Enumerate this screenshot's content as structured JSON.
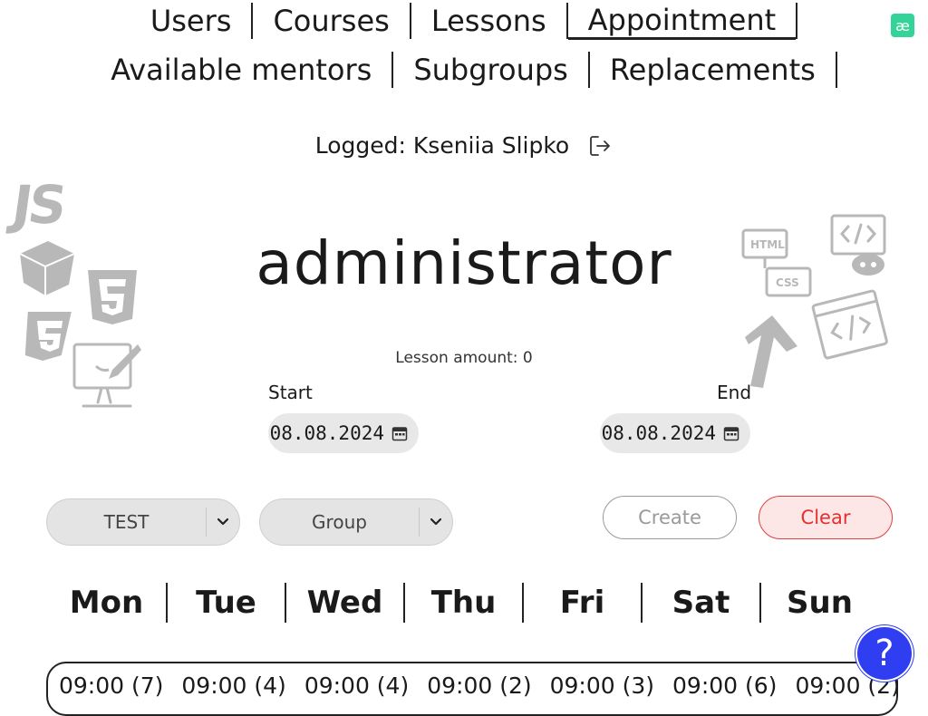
{
  "nav": {
    "row1": [
      "Users",
      "Courses",
      "Lessons",
      "Appointment"
    ],
    "row2": [
      "Available mentors",
      "Subgroups",
      "Replacements"
    ],
    "active": "Appointment"
  },
  "lang_button": {
    "label": "æ",
    "color": "#34d399"
  },
  "user": {
    "logged_text": "Logged: Kseniia Slipko",
    "logout_icon": "logout-icon"
  },
  "role": "administrator",
  "lesson_amount": "Lesson amount: 0",
  "start": {
    "label": "Start",
    "value": "08.08.2024"
  },
  "end": {
    "label": "End",
    "value": "08.08.2024"
  },
  "course_select": {
    "value": "TEST"
  },
  "group_select": {
    "value": "Group"
  },
  "buttons": {
    "create": "Create",
    "clear": "Clear"
  },
  "days": [
    "Mon",
    "Tue",
    "Wed",
    "Thu",
    "Fri",
    "Sat",
    "Sun"
  ],
  "slots": [
    "09:00 (7)",
    "09:00 (4)",
    "09:00 (4)",
    "09:00 (2)",
    "09:00 (3)",
    "09:00 (6)",
    "09:00 (2)"
  ],
  "help": {
    "label": "?",
    "color": "#2f3ef0"
  },
  "colors": {
    "accent_green": "#34d399",
    "clear_red": "#e53030",
    "help_blue": "#2f3ef0",
    "decor_gray": "#b8b8b8"
  }
}
